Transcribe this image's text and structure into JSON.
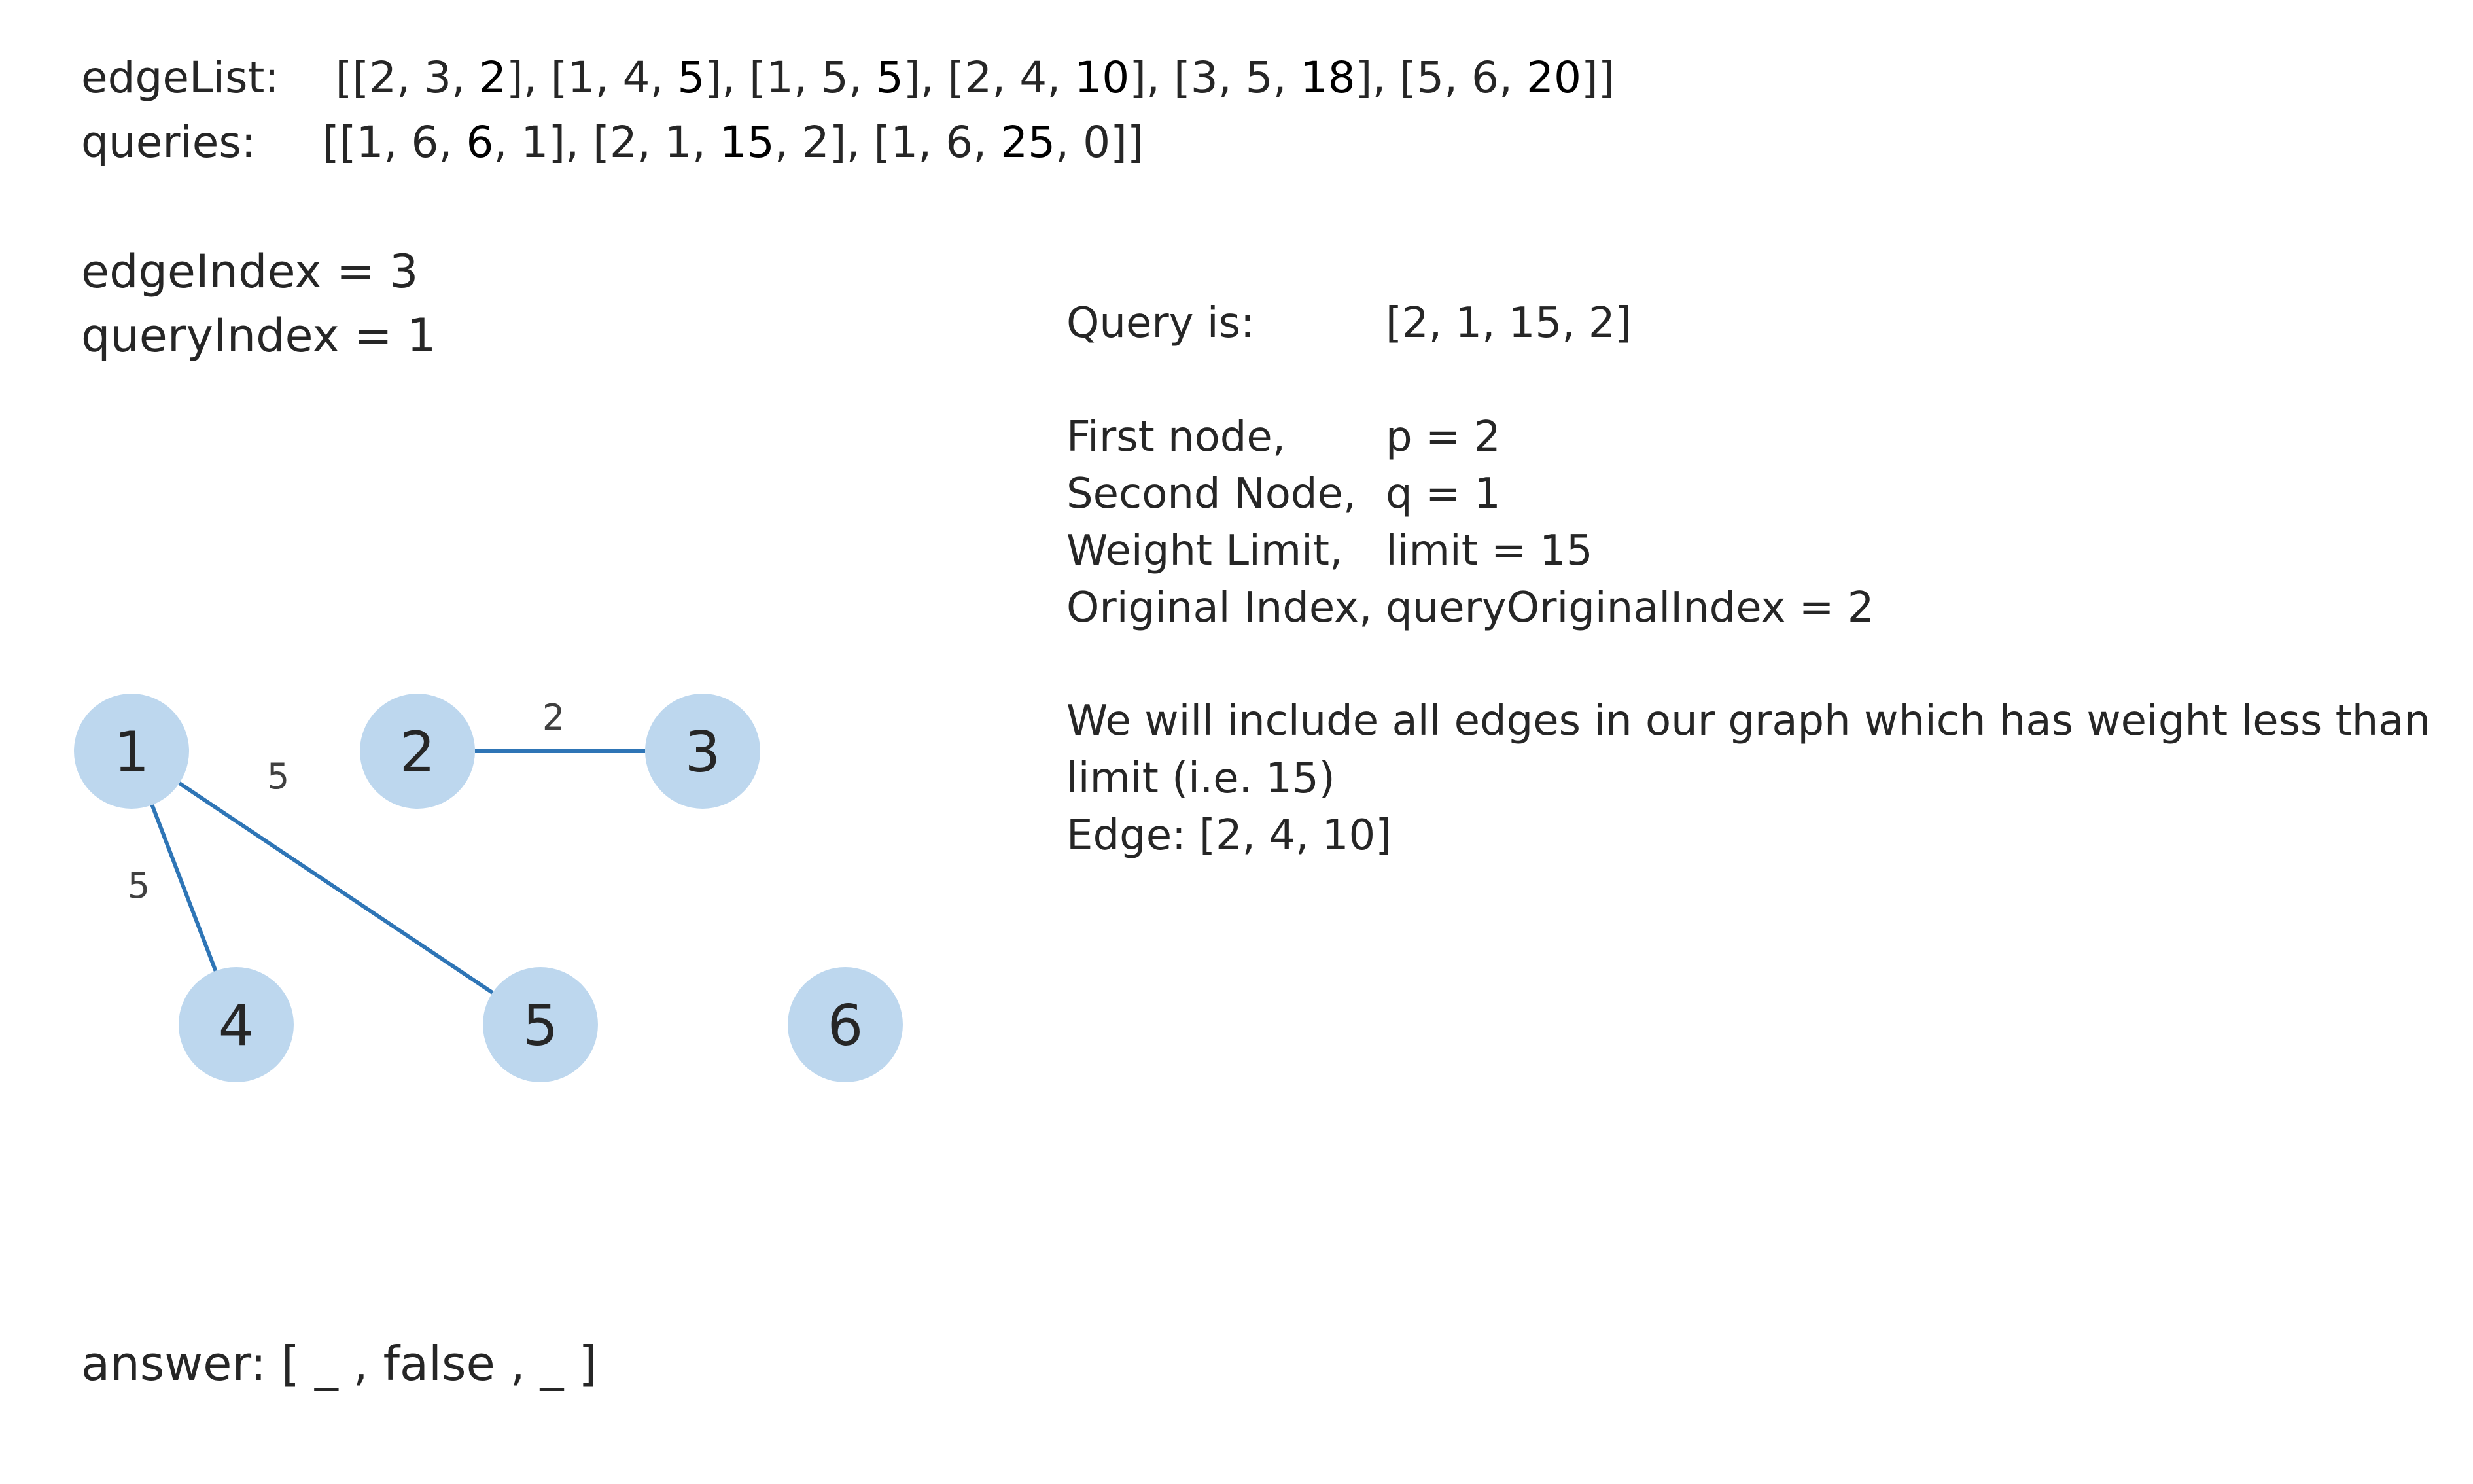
{
  "edge_list": {
    "label": "edgeList:",
    "open": "[",
    "close": "]",
    "items": [
      {
        "a": "2",
        "b": "3",
        "w": "2"
      },
      {
        "a": "1",
        "b": "4",
        "w": "5"
      },
      {
        "a": "1",
        "b": "5",
        "w": "5"
      },
      {
        "a": "2",
        "b": "4",
        "w": "10"
      },
      {
        "a": "3",
        "b": "5",
        "w": "18"
      },
      {
        "a": "5",
        "b": "6",
        "w": "20"
      }
    ]
  },
  "queries": {
    "label": "queries:",
    "open": "[",
    "close": "]",
    "items": [
      {
        "a": "1",
        "b": "6",
        "w": "6",
        "i": "1"
      },
      {
        "a": "2",
        "b": "1",
        "w": "15",
        "i": "2"
      },
      {
        "a": "1",
        "b": "6",
        "w": "25",
        "i": "0"
      }
    ]
  },
  "state": {
    "edge_index": "edgeIndex = 3",
    "query_index": "queryIndex = 1"
  },
  "query_info": {
    "query_label": "Query is:",
    "query_value": "[2, 1, 15, 2]",
    "first_label": "First node,",
    "first_value": "p = 2",
    "second_label": "Second Node,",
    "second_value": "q = 1",
    "limit_label": "Weight Limit,",
    "limit_value": "limit = 15",
    "orig_label": "Original Index,",
    "orig_value": "queryOriginalIndex = 2",
    "desc_line1": "We will include all edges in our graph which has weight less than",
    "desc_line2": "limit (i.e. 15)",
    "edge_line": "Edge: [2, 4, 10]"
  },
  "graph": {
    "node_color": "#bdd7ee",
    "edge_color": "#2e75b6",
    "nodes": [
      "1",
      "2",
      "3",
      "4",
      "5",
      "6"
    ],
    "edges": [
      {
        "from": "2",
        "to": "3",
        "weight": "2"
      },
      {
        "from": "1",
        "to": "5",
        "weight": "5"
      },
      {
        "from": "1",
        "to": "4",
        "weight": "5"
      }
    ]
  },
  "answer": {
    "text": "answer:  [ _ , false , _ ]"
  }
}
